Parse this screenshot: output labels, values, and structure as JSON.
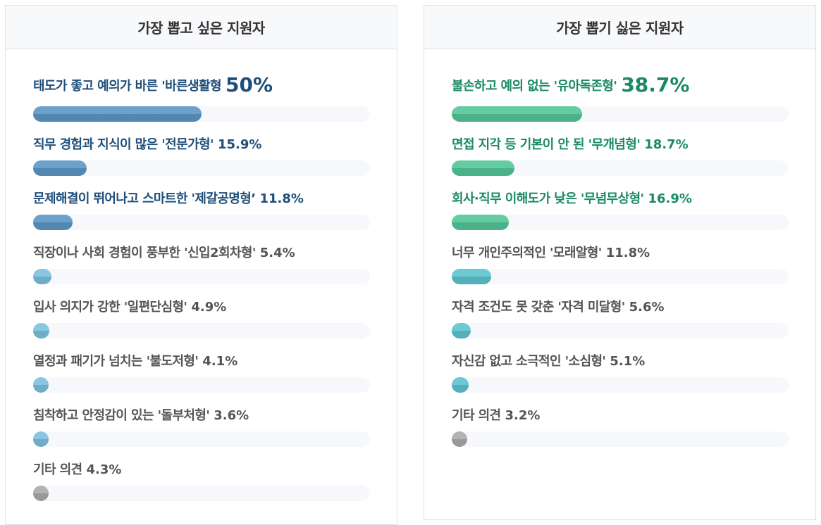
{
  "colors": {
    "blue_text": "#1e4e79",
    "gray_text": "#555555",
    "green_text": "#1a8a66",
    "blue_bar": "#5b96c5",
    "light_blue_bar": "#7cbfde",
    "gray_bar": "#aaaaaa",
    "green_bar": "#52c597",
    "teal_bar": "#5cc3cf"
  },
  "chart_data": [
    {
      "type": "bar",
      "title": "가장 뽑고 싶은 지원자",
      "categories": [
        "태도가 좋고 예의가 바른 '바른생활형",
        "직무 경험과 지식이 많은 '전문가형'",
        "문제해결이 뛰어나고 스마트한 '제갈공명형’",
        "직장이나 사회 경험이 풍부한 '신입2회차형'",
        "입사 의지가 강한 '일편단심형'",
        "열정과 패기가 넘치는 '불도저형'",
        "침착하고 안정감이 있는 '돌부처형'",
        "기타 의견"
      ],
      "values": [
        50,
        15.9,
        11.8,
        5.4,
        4.9,
        4.1,
        3.6,
        4.3
      ],
      "value_labels": [
        "50%",
        "15.9%",
        "11.8%",
        "5.4%",
        "4.9%",
        "4.1%",
        "3.6%",
        "4.3%"
      ],
      "text_colors": [
        "blue_text",
        "blue_text",
        "blue_text",
        "gray_text",
        "gray_text",
        "gray_text",
        "gray_text",
        "gray_text"
      ],
      "bar_colors": [
        "blue_bar",
        "blue_bar",
        "blue_bar",
        "light_blue_bar",
        "light_blue_bar",
        "light_blue_bar",
        "light_blue_bar",
        "gray_bar"
      ],
      "xlim": [
        0,
        100
      ]
    },
    {
      "type": "bar",
      "title": "가장 뽑기 싫은 지원자",
      "categories": [
        "불손하고 예의 없는 '유아독존형'",
        "면접 지각 등 기본이 안 된 '무개념형'",
        "회사·직무 이해도가 낮은 '무념무상형'",
        "너무 개인주의적인 '모래알형'",
        "자격 조건도 못 갖춘 '자격 미달형'",
        "자신감 없고 소극적인 '소심형'",
        "기타 의견"
      ],
      "values": [
        38.7,
        18.7,
        16.9,
        11.8,
        5.6,
        5.1,
        3.2
      ],
      "value_labels": [
        "38.7%",
        "18.7%",
        "16.9%",
        "11.8%",
        "5.6%",
        "5.1%",
        "3.2%"
      ],
      "text_colors": [
        "green_text",
        "green_text",
        "green_text",
        "gray_text",
        "gray_text",
        "gray_text",
        "gray_text"
      ],
      "bar_colors": [
        "green_bar",
        "green_bar",
        "green_bar",
        "teal_bar",
        "teal_bar",
        "teal_bar",
        "gray_bar"
      ],
      "xlim": [
        0,
        100
      ]
    }
  ]
}
